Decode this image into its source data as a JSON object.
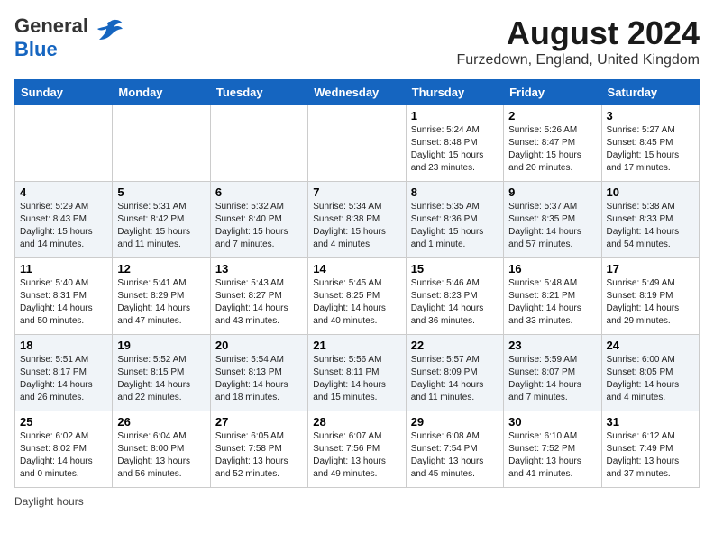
{
  "header": {
    "logo_line1": "General",
    "logo_line2": "Blue",
    "main_title": "August 2024",
    "subtitle": "Furzedown, England, United Kingdom"
  },
  "columns": [
    "Sunday",
    "Monday",
    "Tuesday",
    "Wednesday",
    "Thursday",
    "Friday",
    "Saturday"
  ],
  "footer": {
    "daylight_label": "Daylight hours"
  },
  "weeks": [
    [
      {
        "day": "",
        "info": ""
      },
      {
        "day": "",
        "info": ""
      },
      {
        "day": "",
        "info": ""
      },
      {
        "day": "",
        "info": ""
      },
      {
        "day": "1",
        "info": "Sunrise: 5:24 AM\nSunset: 8:48 PM\nDaylight: 15 hours\nand 23 minutes."
      },
      {
        "day": "2",
        "info": "Sunrise: 5:26 AM\nSunset: 8:47 PM\nDaylight: 15 hours\nand 20 minutes."
      },
      {
        "day": "3",
        "info": "Sunrise: 5:27 AM\nSunset: 8:45 PM\nDaylight: 15 hours\nand 17 minutes."
      }
    ],
    [
      {
        "day": "4",
        "info": "Sunrise: 5:29 AM\nSunset: 8:43 PM\nDaylight: 15 hours\nand 14 minutes."
      },
      {
        "day": "5",
        "info": "Sunrise: 5:31 AM\nSunset: 8:42 PM\nDaylight: 15 hours\nand 11 minutes."
      },
      {
        "day": "6",
        "info": "Sunrise: 5:32 AM\nSunset: 8:40 PM\nDaylight: 15 hours\nand 7 minutes."
      },
      {
        "day": "7",
        "info": "Sunrise: 5:34 AM\nSunset: 8:38 PM\nDaylight: 15 hours\nand 4 minutes."
      },
      {
        "day": "8",
        "info": "Sunrise: 5:35 AM\nSunset: 8:36 PM\nDaylight: 15 hours\nand 1 minute."
      },
      {
        "day": "9",
        "info": "Sunrise: 5:37 AM\nSunset: 8:35 PM\nDaylight: 14 hours\nand 57 minutes."
      },
      {
        "day": "10",
        "info": "Sunrise: 5:38 AM\nSunset: 8:33 PM\nDaylight: 14 hours\nand 54 minutes."
      }
    ],
    [
      {
        "day": "11",
        "info": "Sunrise: 5:40 AM\nSunset: 8:31 PM\nDaylight: 14 hours\nand 50 minutes."
      },
      {
        "day": "12",
        "info": "Sunrise: 5:41 AM\nSunset: 8:29 PM\nDaylight: 14 hours\nand 47 minutes."
      },
      {
        "day": "13",
        "info": "Sunrise: 5:43 AM\nSunset: 8:27 PM\nDaylight: 14 hours\nand 43 minutes."
      },
      {
        "day": "14",
        "info": "Sunrise: 5:45 AM\nSunset: 8:25 PM\nDaylight: 14 hours\nand 40 minutes."
      },
      {
        "day": "15",
        "info": "Sunrise: 5:46 AM\nSunset: 8:23 PM\nDaylight: 14 hours\nand 36 minutes."
      },
      {
        "day": "16",
        "info": "Sunrise: 5:48 AM\nSunset: 8:21 PM\nDaylight: 14 hours\nand 33 minutes."
      },
      {
        "day": "17",
        "info": "Sunrise: 5:49 AM\nSunset: 8:19 PM\nDaylight: 14 hours\nand 29 minutes."
      }
    ],
    [
      {
        "day": "18",
        "info": "Sunrise: 5:51 AM\nSunset: 8:17 PM\nDaylight: 14 hours\nand 26 minutes."
      },
      {
        "day": "19",
        "info": "Sunrise: 5:52 AM\nSunset: 8:15 PM\nDaylight: 14 hours\nand 22 minutes."
      },
      {
        "day": "20",
        "info": "Sunrise: 5:54 AM\nSunset: 8:13 PM\nDaylight: 14 hours\nand 18 minutes."
      },
      {
        "day": "21",
        "info": "Sunrise: 5:56 AM\nSunset: 8:11 PM\nDaylight: 14 hours\nand 15 minutes."
      },
      {
        "day": "22",
        "info": "Sunrise: 5:57 AM\nSunset: 8:09 PM\nDaylight: 14 hours\nand 11 minutes."
      },
      {
        "day": "23",
        "info": "Sunrise: 5:59 AM\nSunset: 8:07 PM\nDaylight: 14 hours\nand 7 minutes."
      },
      {
        "day": "24",
        "info": "Sunrise: 6:00 AM\nSunset: 8:05 PM\nDaylight: 14 hours\nand 4 minutes."
      }
    ],
    [
      {
        "day": "25",
        "info": "Sunrise: 6:02 AM\nSunset: 8:02 PM\nDaylight: 14 hours\nand 0 minutes."
      },
      {
        "day": "26",
        "info": "Sunrise: 6:04 AM\nSunset: 8:00 PM\nDaylight: 13 hours\nand 56 minutes."
      },
      {
        "day": "27",
        "info": "Sunrise: 6:05 AM\nSunset: 7:58 PM\nDaylight: 13 hours\nand 52 minutes."
      },
      {
        "day": "28",
        "info": "Sunrise: 6:07 AM\nSunset: 7:56 PM\nDaylight: 13 hours\nand 49 minutes."
      },
      {
        "day": "29",
        "info": "Sunrise: 6:08 AM\nSunset: 7:54 PM\nDaylight: 13 hours\nand 45 minutes."
      },
      {
        "day": "30",
        "info": "Sunrise: 6:10 AM\nSunset: 7:52 PM\nDaylight: 13 hours\nand 41 minutes."
      },
      {
        "day": "31",
        "info": "Sunrise: 6:12 AM\nSunset: 7:49 PM\nDaylight: 13 hours\nand 37 minutes."
      }
    ]
  ]
}
